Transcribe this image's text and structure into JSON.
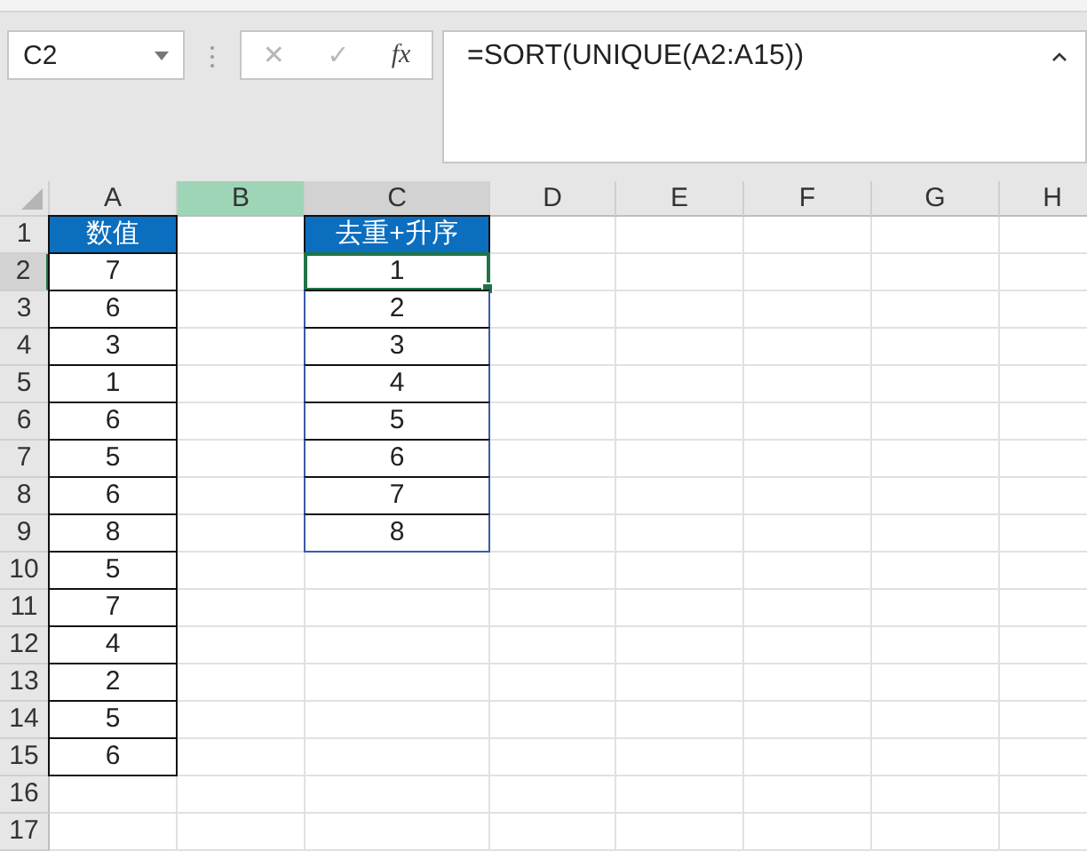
{
  "formula_bar": {
    "name_box": "C2",
    "cancel": "✕",
    "enter": "✓",
    "function": "fx",
    "formula": "=SORT(UNIQUE(A2:A15))"
  },
  "sheet": {
    "columns": [
      {
        "label": "A",
        "selected": false,
        "highlighted": false
      },
      {
        "label": "B",
        "selected": false,
        "highlighted": true
      },
      {
        "label": "C",
        "selected": true,
        "highlighted": false
      },
      {
        "label": "D",
        "selected": false,
        "highlighted": false
      },
      {
        "label": "E",
        "selected": false,
        "highlighted": false
      },
      {
        "label": "F",
        "selected": false,
        "highlighted": false
      },
      {
        "label": "G",
        "selected": false,
        "highlighted": false
      },
      {
        "label": "H",
        "selected": false,
        "highlighted": false
      }
    ],
    "rows": [
      {
        "number": "1",
        "selected": false,
        "a": {
          "text": "数值",
          "kind": "header",
          "selected": false
        },
        "c": {
          "text": "去重+升序",
          "kind": "header",
          "selected": false
        }
      },
      {
        "number": "2",
        "selected": true,
        "a": {
          "text": "7",
          "kind": "data",
          "selected": false
        },
        "c": {
          "text": "1",
          "kind": "spill",
          "selected": true
        }
      },
      {
        "number": "3",
        "selected": false,
        "a": {
          "text": "6",
          "kind": "data",
          "selected": false
        },
        "c": {
          "text": "2",
          "kind": "spill",
          "selected": false
        }
      },
      {
        "number": "4",
        "selected": false,
        "a": {
          "text": "3",
          "kind": "data",
          "selected": false
        },
        "c": {
          "text": "3",
          "kind": "spill",
          "selected": false
        }
      },
      {
        "number": "5",
        "selected": false,
        "a": {
          "text": "1",
          "kind": "data",
          "selected": false
        },
        "c": {
          "text": "4",
          "kind": "spill",
          "selected": false
        }
      },
      {
        "number": "6",
        "selected": false,
        "a": {
          "text": "6",
          "kind": "data",
          "selected": false
        },
        "c": {
          "text": "5",
          "kind": "spill",
          "selected": false
        }
      },
      {
        "number": "7",
        "selected": false,
        "a": {
          "text": "5",
          "kind": "data",
          "selected": false
        },
        "c": {
          "text": "6",
          "kind": "spill",
          "selected": false
        }
      },
      {
        "number": "8",
        "selected": false,
        "a": {
          "text": "6",
          "kind": "data",
          "selected": false
        },
        "c": {
          "text": "7",
          "kind": "spill",
          "selected": false
        }
      },
      {
        "number": "9",
        "selected": false,
        "a": {
          "text": "8",
          "kind": "data",
          "selected": false
        },
        "c": {
          "text": "8",
          "kind": "spill",
          "selected": false
        }
      },
      {
        "number": "10",
        "selected": false,
        "a": {
          "text": "5",
          "kind": "data",
          "selected": false
        }
      },
      {
        "number": "11",
        "selected": false,
        "a": {
          "text": "7",
          "kind": "data",
          "selected": false
        }
      },
      {
        "number": "12",
        "selected": false,
        "a": {
          "text": "4",
          "kind": "data",
          "selected": false
        }
      },
      {
        "number": "13",
        "selected": false,
        "a": {
          "text": "2",
          "kind": "data",
          "selected": false
        }
      },
      {
        "number": "14",
        "selected": false,
        "a": {
          "text": "5",
          "kind": "data",
          "selected": false
        }
      },
      {
        "number": "15",
        "selected": false,
        "a": {
          "text": "6",
          "kind": "data",
          "selected": false
        }
      },
      {
        "number": "16",
        "selected": false
      },
      {
        "number": "17",
        "selected": false
      }
    ]
  }
}
